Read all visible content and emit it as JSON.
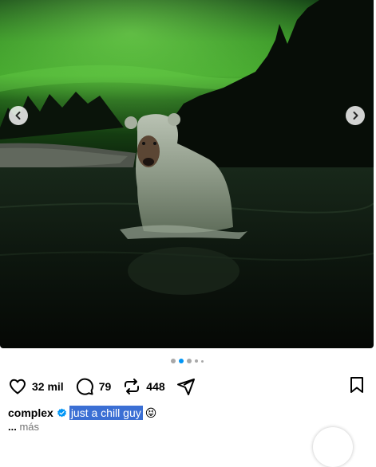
{
  "post": {
    "image_description_icon": "photo",
    "slides": {
      "total": 5,
      "active_index": 1
    }
  },
  "carousel": {
    "prev_icon": "chevron-left-icon",
    "next_icon": "chevron-right-icon"
  },
  "actions": {
    "likes": "32 mil",
    "comments": "79",
    "reposts": "448"
  },
  "caption": {
    "username": "complex",
    "text": "just a chill guy",
    "emoji": "😝",
    "more_ellipsis": "...",
    "more_label": "más"
  },
  "colors": {
    "accent_blue": "#0095f6",
    "selection": "#3b6fd4",
    "aurora_green": "#3fae2a"
  }
}
